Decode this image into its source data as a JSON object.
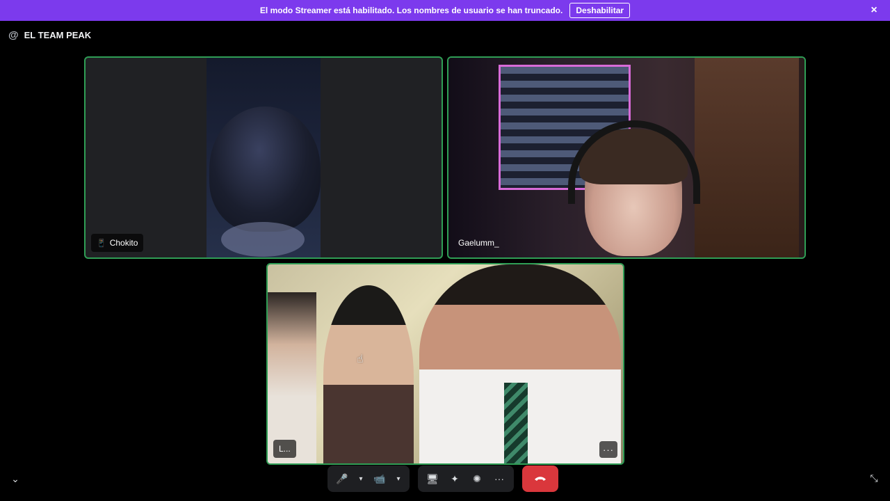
{
  "banner": {
    "message": "El modo Streamer está habilitado. Los nombres de usuario se han truncado.",
    "button_label": "Deshabilitar",
    "close_icon": "×",
    "color": "#7c3aed"
  },
  "header": {
    "at_icon": "@",
    "channel_name": "EL TEAM PEAK"
  },
  "participants": [
    {
      "name": "Chokito",
      "device_icon": "📱",
      "speaking_border": "#2f9e55"
    },
    {
      "name": "Gaelumm_",
      "speaking_border": "#2f9e55"
    },
    {
      "name": "L...",
      "more_label": "···",
      "speaking_border": "#2f9e55"
    }
  ],
  "controls": {
    "mic_icon": "🎤",
    "mic_menu_icon": "▾",
    "camera_icon": "📹",
    "camera_menu_icon": "▾",
    "screenshare_icon": "🖥",
    "activities_icon": "✦",
    "soundboard_icon": "✺",
    "more_icon": "···",
    "hangup_color": "#da373c"
  },
  "bottom": {
    "collapse_icon": "⌄",
    "exit_fullscreen_icon": "⤡"
  }
}
